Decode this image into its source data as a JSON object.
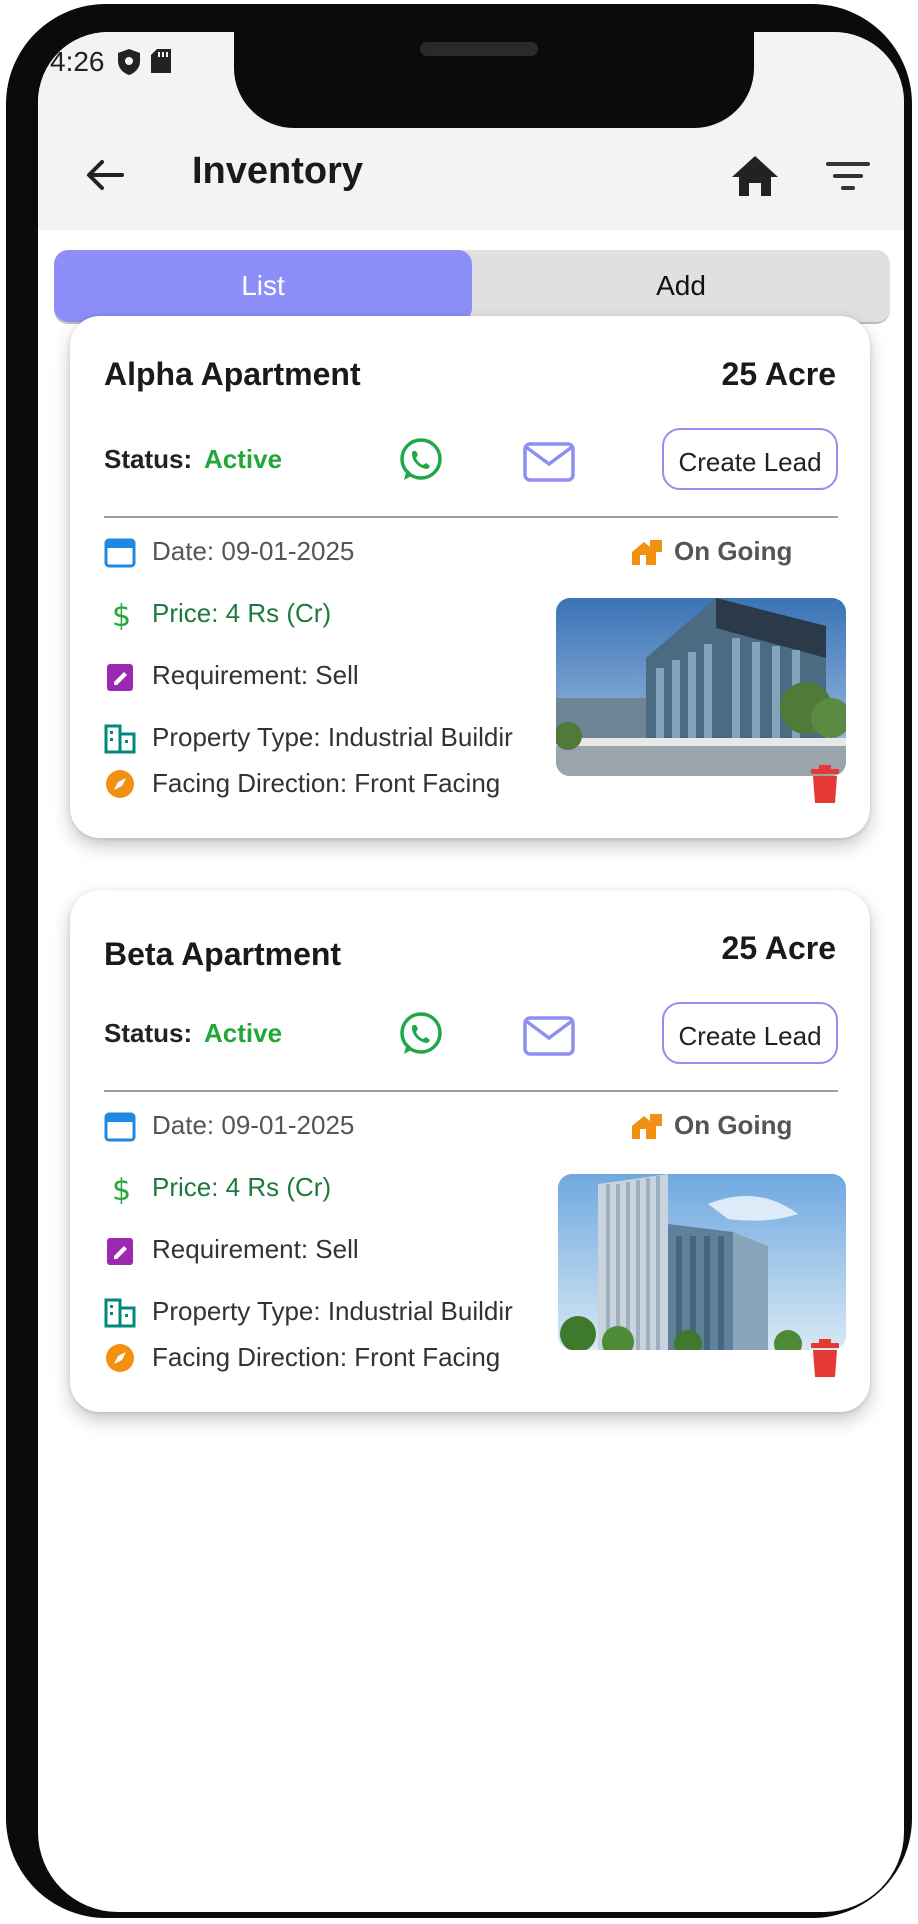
{
  "status_bar": {
    "time": "4:26"
  },
  "app_bar": {
    "title": "Inventory"
  },
  "tabs": [
    {
      "label": "List"
    },
    {
      "label": "Add"
    }
  ],
  "colors": {
    "accent": "#8c8ff7",
    "active_status": "#22a83a",
    "price": "#1e7a3c",
    "delete": "#e53935",
    "ongoing": "#f29111"
  },
  "properties": [
    {
      "name": "Alpha Apartment",
      "area": "25 Acre",
      "status_label": "Status:",
      "status_value": "Active",
      "create_lead_label": "Create Lead",
      "date": "Date: 09-01-2025",
      "progress": "On Going",
      "price": "Price: 4 Rs (Cr)",
      "requirement": "Requirement: Sell",
      "property_type": "Property Type: Industrial Buildir",
      "facing": "Facing Direction: Front Facing",
      "image_icon": "low-rise-glass-building-photo"
    },
    {
      "name": "Beta Apartment",
      "area": "25 Acre",
      "status_label": "Status:",
      "status_value": "Active",
      "create_lead_label": "Create Lead",
      "date": "Date: 09-01-2025",
      "progress": "On Going",
      "price": "Price: 4 Rs (Cr)",
      "requirement": "Requirement: Sell",
      "property_type": "Property Type: Industrial Buildir",
      "facing": "Facing Direction: Front Facing",
      "image_icon": "tall-glass-tower-photo"
    }
  ]
}
